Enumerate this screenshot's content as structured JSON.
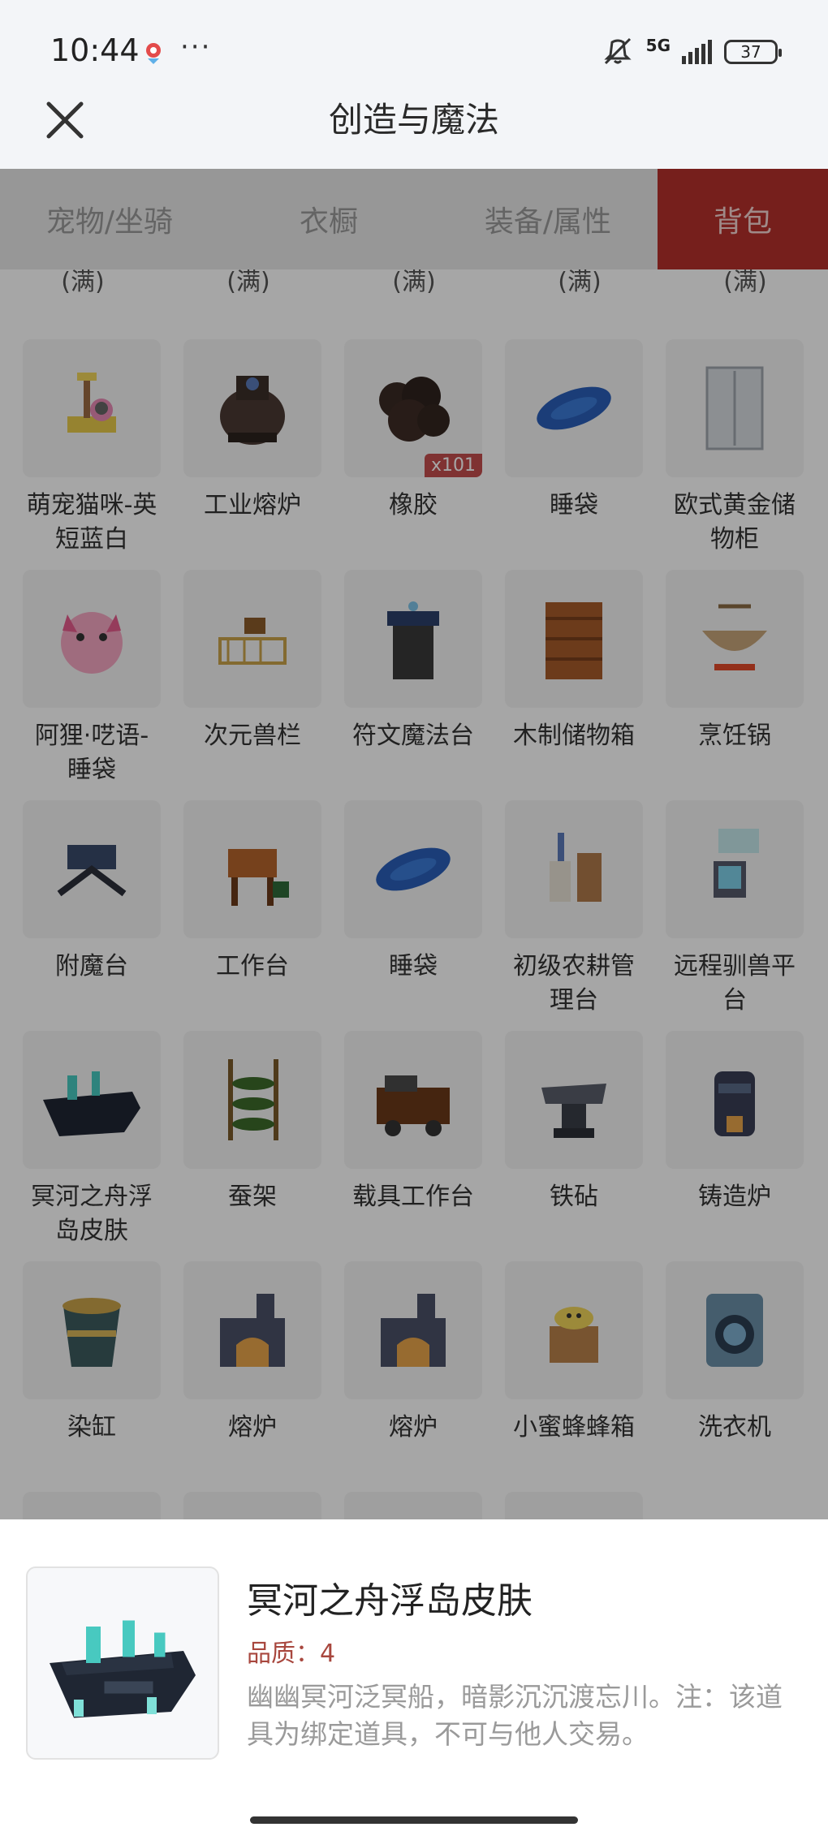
{
  "status": {
    "time": "10:44",
    "dots": "···",
    "network": "5G",
    "battery": "37",
    "icons": [
      "location-app-icon",
      "mute-icon",
      "signal-icon",
      "battery-icon"
    ]
  },
  "header": {
    "title": "创造与魔法",
    "close_icon": "close-icon"
  },
  "tabs": [
    {
      "label": "宠物/坐骑",
      "active": false
    },
    {
      "label": "衣橱",
      "active": false
    },
    {
      "label": "装备/属性",
      "active": false
    },
    {
      "label": "背包",
      "active": true
    }
  ],
  "partial_row": [
    "(满)",
    "(满)",
    "(满)",
    "(满)",
    "(满)"
  ],
  "items": [
    {
      "name": "萌宠猫咪-英短蓝白",
      "count": ""
    },
    {
      "name": "工业熔炉",
      "count": ""
    },
    {
      "name": "橡胶",
      "count": "x101"
    },
    {
      "name": "睡袋",
      "count": ""
    },
    {
      "name": "欧式黄金储物柜",
      "count": ""
    },
    {
      "name": "阿狸·呓语-睡袋",
      "count": ""
    },
    {
      "name": "次元兽栏",
      "count": ""
    },
    {
      "name": "符文魔法台",
      "count": ""
    },
    {
      "name": "木制储物箱",
      "count": ""
    },
    {
      "name": "烹饪锅",
      "count": ""
    },
    {
      "name": "附魔台",
      "count": ""
    },
    {
      "name": "工作台",
      "count": ""
    },
    {
      "name": "睡袋",
      "count": ""
    },
    {
      "name": "初级农耕管理台",
      "count": ""
    },
    {
      "name": "远程驯兽平台",
      "count": ""
    },
    {
      "name": "冥河之舟浮岛皮肤",
      "count": ""
    },
    {
      "name": "蚕架",
      "count": ""
    },
    {
      "name": "载具工作台",
      "count": ""
    },
    {
      "name": "铁砧",
      "count": ""
    },
    {
      "name": "铸造炉",
      "count": ""
    },
    {
      "name": "染缸",
      "count": ""
    },
    {
      "name": "熔炉",
      "count": ""
    },
    {
      "name": "熔炉",
      "count": ""
    },
    {
      "name": "小蜜蜂蜂箱",
      "count": ""
    },
    {
      "name": "洗衣机",
      "count": ""
    },
    {
      "name": "",
      "count": ""
    },
    {
      "name": "",
      "count": ""
    },
    {
      "name": "",
      "count": ""
    },
    {
      "name": "",
      "count": ""
    }
  ],
  "detail": {
    "name": "冥河之舟浮岛皮肤",
    "quality": "品质：4",
    "description": "幽幽冥河泛冥船，暗影沉沉渡忘川。注：该道具为绑定道具，不可与他人交易。"
  },
  "colors": {
    "accent": "#b5302c",
    "quality": "#a8473e"
  }
}
